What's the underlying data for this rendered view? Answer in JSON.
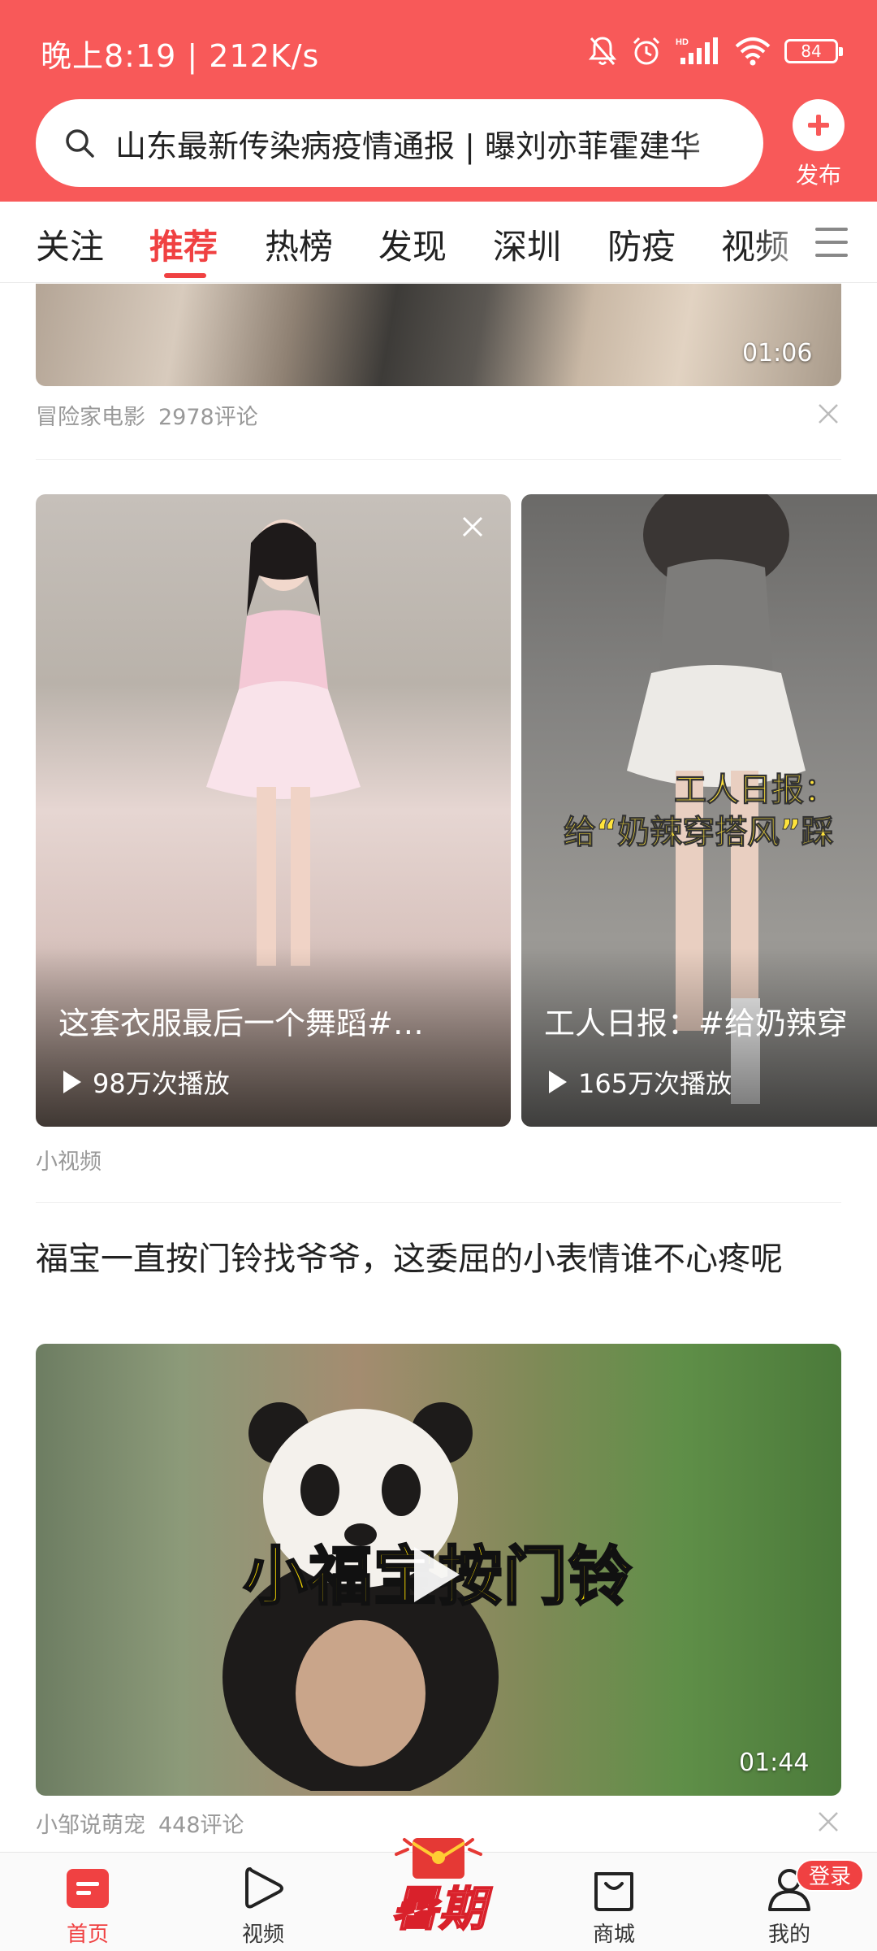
{
  "status_bar": {
    "time_speed": "晚上8:19 | 212K/s",
    "battery": "84"
  },
  "search": {
    "query": "山东最新传染病疫情通报 | 曝刘亦菲霍建华"
  },
  "publish": {
    "label": "发布"
  },
  "tabs": [
    {
      "label": "关注",
      "active": false
    },
    {
      "label": "推荐",
      "active": true
    },
    {
      "label": "热榜",
      "active": false
    },
    {
      "label": "发现",
      "active": false
    },
    {
      "label": "深圳",
      "active": false
    },
    {
      "label": "防疫",
      "active": false
    },
    {
      "label": "视频",
      "active": false
    }
  ],
  "feed": {
    "item1": {
      "duration": "01:06",
      "source": "冒险家电影",
      "comments": "2978评论"
    },
    "small_videos": {
      "label": "小视频",
      "cards": [
        {
          "title": "这套衣服最后一个舞蹈#…",
          "plays": "98万次播放"
        },
        {
          "title": "工人日报：#给奶辣穿",
          "plays": "165万次播放",
          "overlay_line1": "工人日报：",
          "overlay_line2": "给“奶辣穿搭风”踩"
        }
      ]
    },
    "item3": {
      "title": "福宝一直按门铃找爷爷，这委屈的小表情谁不心疼呢",
      "caption": "小福宝按门铃",
      "duration": "01:44",
      "source": "小邹说萌宠",
      "comments": "448评论"
    }
  },
  "bottom_nav": {
    "items": [
      {
        "label": "首页",
        "active": true
      },
      {
        "label": "视频",
        "active": false
      },
      {
        "label": "暑期",
        "active": false
      },
      {
        "label": "商城",
        "active": false
      },
      {
        "label": "我的",
        "active": false
      }
    ],
    "login_badge": "登录"
  },
  "colors": {
    "brand_red": "#f85959",
    "active_tab": "#f04142"
  }
}
